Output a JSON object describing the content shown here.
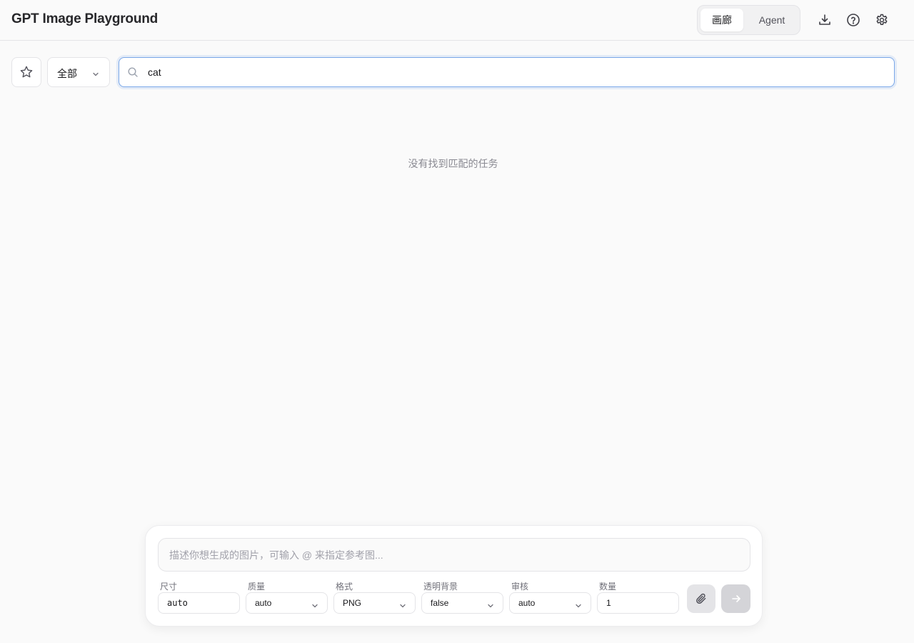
{
  "header": {
    "title": "GPT Image Playground",
    "tabs": [
      {
        "label": "画廊",
        "active": true
      },
      {
        "label": "Agent",
        "active": false
      }
    ],
    "icons": [
      "download-icon",
      "help-icon",
      "settings-icon"
    ]
  },
  "filter": {
    "favorites_icon": "star-icon",
    "scope": {
      "selected": "全部"
    },
    "search": {
      "value": "cat"
    }
  },
  "results": {
    "empty_message": "没有找到匹配的任务"
  },
  "composer": {
    "prompt_placeholder": "描述你想生成的图片，可输入 @ 来指定参考图...",
    "params": {
      "size": {
        "label": "尺寸",
        "value": "auto"
      },
      "quality": {
        "label": "质量",
        "value": "auto"
      },
      "format": {
        "label": "格式",
        "value": "PNG"
      },
      "transparent": {
        "label": "透明背景",
        "value": "false"
      },
      "moderation": {
        "label": "审核",
        "value": "auto"
      },
      "count": {
        "label": "数量",
        "value": "1"
      }
    },
    "attach_icon": "paperclip-icon",
    "send_icon": "arrow-right-icon"
  },
  "colors": {
    "accent_focus": "#7aa7e8",
    "background": "#fafafa"
  }
}
